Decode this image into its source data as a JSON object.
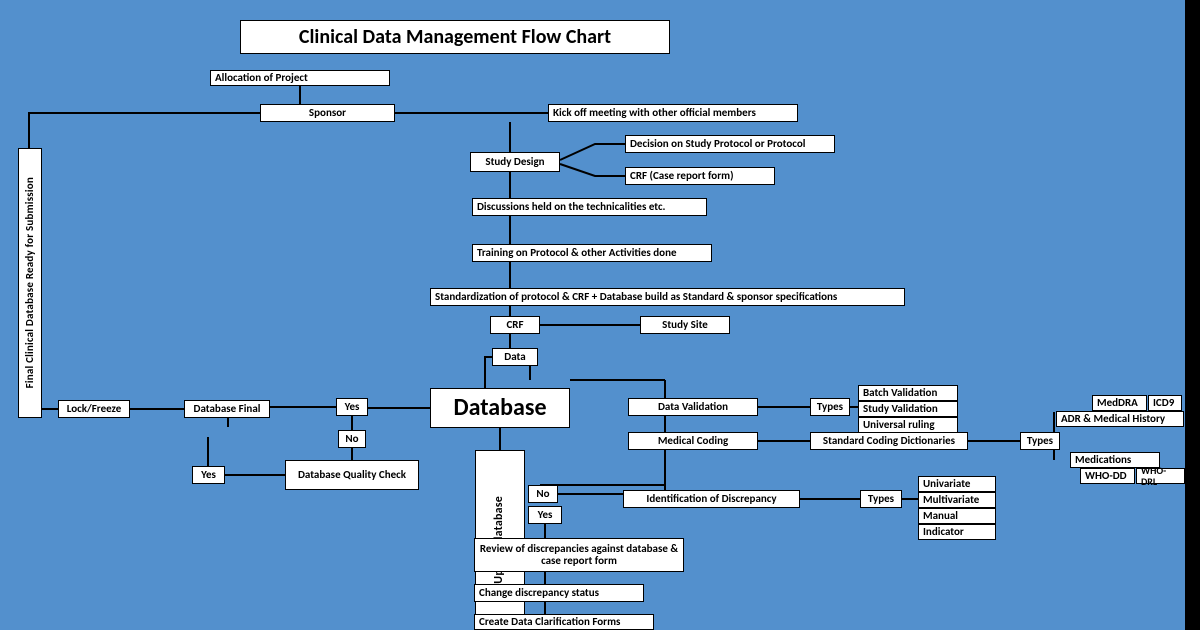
{
  "title": "Clinical Data Management Flow Chart",
  "nodes": {
    "allocation": "Allocation of Project",
    "sponsor": "Sponsor",
    "kickoff": "Kick off meeting with other official members",
    "study_design": "Study Design",
    "decision_protocol": "Decision on Study Protocol or Protocol",
    "crf_form": "CRF (Case report form)",
    "discussions": "Discussions held on the technicalities etc.",
    "training": "Training on Protocol & other Activities done",
    "standardization": "Standardization of protocol & CRF + Database build as Standard & sponsor specifications",
    "crf": "CRF",
    "study_site": "Study Site",
    "data": "Data",
    "database": "Database",
    "update_database": "Update database",
    "data_validation": "Data Validation",
    "types1": "Types",
    "batch_validation": "Batch Validation",
    "study_validation": "Study Validation",
    "universal_ruling": "Universal ruling",
    "medical_coding": "Medical Coding",
    "std_coding_dict": "Standard Coding Dictionaries",
    "types2": "Types",
    "meddra": "MedDRA",
    "icd9": "ICD9",
    "adr_medhist": "ADR & Medical History",
    "medications": "Medications",
    "who_dd": "WHO-DD",
    "who_drl": "WHO-DRL",
    "no2": "No",
    "yes3": "Yes",
    "identification": "Identification of Discrepancy",
    "types3": "Types",
    "univariate": "Univariate",
    "multivariate": "Multivariate",
    "manual": "Manual",
    "indicator": "Indicator",
    "review_disc": "Review of discrepancies against database & case report form",
    "change_status": "Change discrepancy status",
    "create_dcf": "Create Data Clarification Forms",
    "yes1": "Yes",
    "no1": "No",
    "db_quality": "Database Quality Check",
    "db_final": "Database Final",
    "yes2": "Yes",
    "lock_freeze": "Lock/Freeze",
    "final_db_ready": "Final Clinical Database Ready for Submission"
  }
}
